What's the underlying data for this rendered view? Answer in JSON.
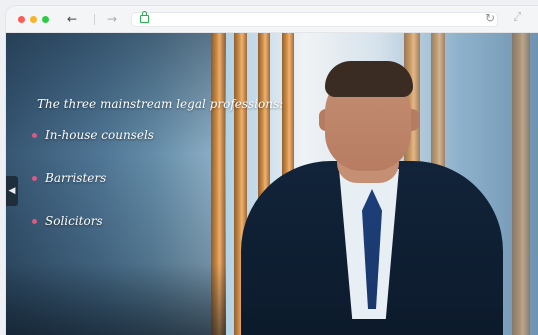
{
  "browser": {
    "traffic_lights": [
      "#fc5b57",
      "#f7b52c",
      "#2ecb4a"
    ],
    "back_icon": "arrow-left-icon",
    "forward_icon": "arrow-right-icon",
    "address_bar": {
      "value": "",
      "lock_icon": "lock-icon"
    },
    "reload_icon": "reload-icon",
    "extension_icon": "expand-icon"
  },
  "slide": {
    "heading": "The three mainstream legal professions:",
    "items": [
      {
        "label": "In-house counsels"
      },
      {
        "label": "Barristers"
      },
      {
        "label": "Solicitors"
      }
    ],
    "bullet_color": "#d95a82",
    "prev_icon": "chevron-left-icon"
  }
}
